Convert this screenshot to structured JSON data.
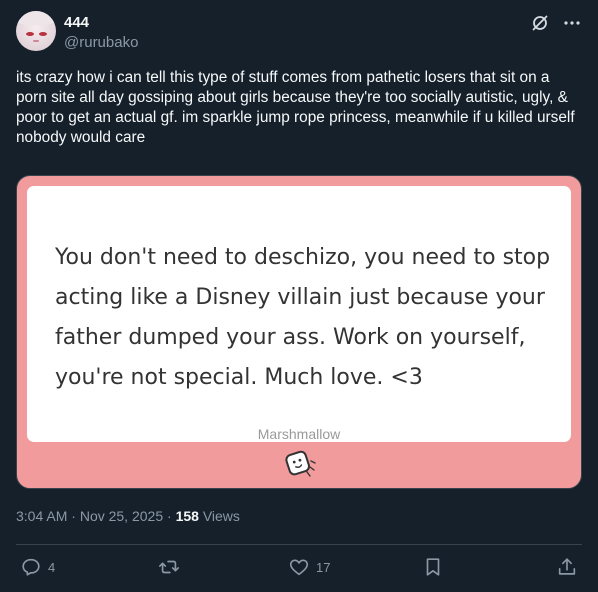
{
  "user": {
    "display_name": "444",
    "handle": "@rurubako"
  },
  "tweet": {
    "text": "its crazy how i can tell this type of stuff comes from pathetic losers that sit on a porn site all day gossiping about girls because they're too socially autistic, ugly, & poor to get an actual gf. im sparkle jump rope princess, meanwhile if u killed urself nobody would care"
  },
  "card": {
    "message": "You don't need to deschizo, you need to stop acting like a Disney villain just because your father dumped your ass. Work on yourself, you're not special. Much love. <3",
    "footer": "Marshmallow",
    "background_color": "#f19b9d"
  },
  "meta": {
    "time": "3:04 AM",
    "separator": "·",
    "date": "Nov 25, 2025",
    "views_count": "158",
    "views_label": "Views"
  },
  "actions": {
    "replies": "4",
    "retweets": "",
    "likes": "17"
  },
  "icons": {
    "grok": "grok-icon",
    "more": "more-icon",
    "reply": "reply-icon",
    "retweet": "retweet-icon",
    "like": "heart-icon",
    "bookmark": "bookmark-icon",
    "share": "share-icon",
    "mallow": "marshmallow-icon"
  }
}
